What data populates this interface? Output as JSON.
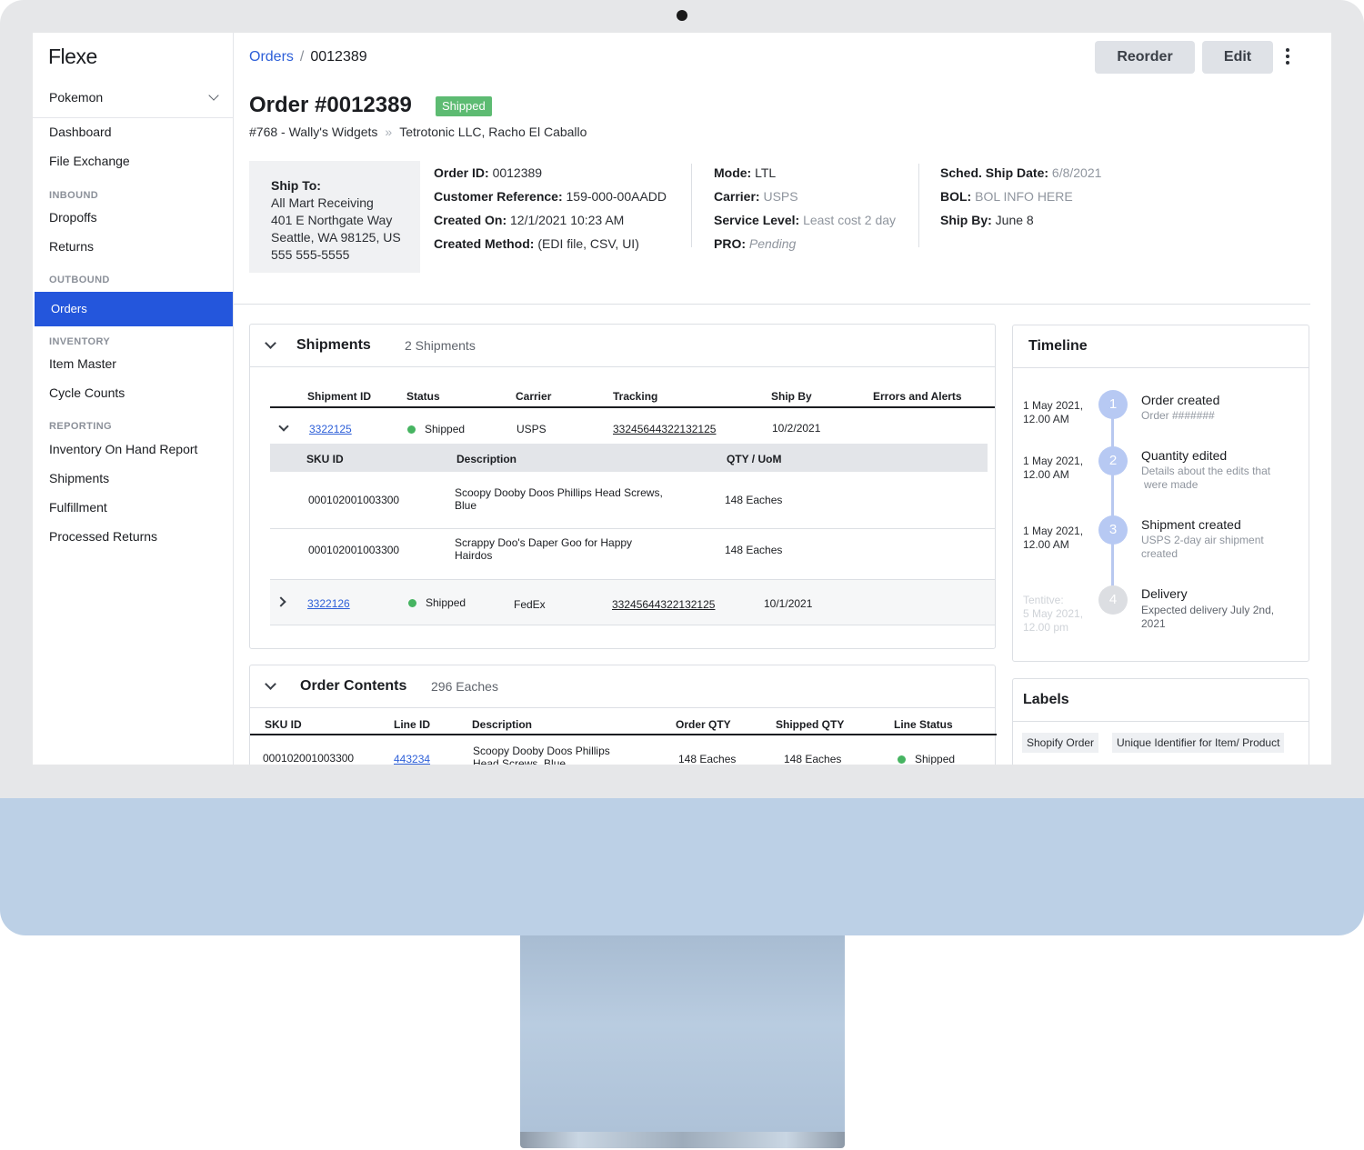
{
  "sidebar": {
    "logo": "Flexe",
    "workspace": "Pokemon",
    "items": {
      "dashboard": "Dashboard",
      "file_exchange": "File Exchange",
      "inbound": "INBOUND",
      "dropoffs": "Dropoffs",
      "returns": "Returns",
      "outbound": "OUTBOUND",
      "orders": "Orders",
      "inventory": "INVENTORY",
      "item_master": "Item Master",
      "cycle_counts": "Cycle Counts",
      "reporting": "REPORTING",
      "inventory_on_hand": "Inventory On Hand Report",
      "shipments": "Shipments",
      "fulfillment": "Fulfillment",
      "processed_returns": "Processed Returns"
    }
  },
  "header": {
    "breadcrumb_link": "Orders",
    "breadcrumb_sep": "/",
    "breadcrumb_current": "0012389",
    "reorder": "Reorder",
    "edit": "Edit"
  },
  "order": {
    "title": "Order #0012389",
    "status": "Shipped",
    "account": "#768 - Wally's Widgets",
    "separator": "»",
    "partner": "Tetrotonic LLC, Racho El Caballo"
  },
  "ship_to": {
    "label": "Ship To:",
    "line1": "All Mart Receiving",
    "line2": "401 E Northgate Way",
    "line3": "Seattle, WA 98125, US",
    "line4": "555 555-5555"
  },
  "details": {
    "order_id_label": "Order ID:",
    "order_id": "0012389",
    "cust_ref_label": "Customer Reference:",
    "cust_ref": "159-000-00AADD",
    "created_on_label": "Created On:",
    "created_on": "12/1/2021 10:23 AM",
    "created_method_label": "Created Method:",
    "created_method": "(EDI file, CSV, UI)",
    "mode_label": "Mode:",
    "mode": "LTL",
    "carrier_label": "Carrier:",
    "carrier": "USPS",
    "service_label": "Service Level:",
    "service": "Least cost 2 day",
    "pro_label": "PRO:",
    "pro": "Pending",
    "sched_label": "Sched. Ship Date:",
    "sched": "6/8/2021",
    "bol_label": "BOL:",
    "bol": "BOL INFO HERE",
    "ship_by_label": "Ship By:",
    "ship_by": "June 8"
  },
  "shipments": {
    "title": "Shipments",
    "count": "2 Shipments",
    "headers": [
      "Shipment ID",
      "Status",
      "Carrier",
      "Tracking",
      "Ship By",
      "Errors and Alerts"
    ],
    "sub_headers": [
      "SKU ID",
      "Description",
      "QTY / UoM"
    ],
    "rows": [
      {
        "id": "3322125",
        "status": "Shipped",
        "carrier": "USPS",
        "tracking": "33245644322132125",
        "ship_by": "10/2/2021",
        "items": [
          {
            "sku": "000102001003300",
            "desc1": "Scoopy Dooby Doos Phillips Head Screws,",
            "desc2": "Blue",
            "qty": "148 Eaches"
          },
          {
            "sku": "000102001003300",
            "desc1": "Scrappy Doo's Daper Goo for Happy",
            "desc2": "Hairdos",
            "qty": "148 Eaches"
          }
        ]
      },
      {
        "id": "3322126",
        "status": "Shipped",
        "carrier": "FedEx",
        "tracking": "33245644322132125",
        "ship_by": "10/1/2021"
      }
    ]
  },
  "contents": {
    "title": "Order Contents",
    "count": "296 Eaches",
    "headers": [
      "SKU ID",
      "Line ID",
      "Description",
      "Order QTY",
      "Shipped QTY",
      "Line Status"
    ],
    "rows": [
      {
        "sku": "000102001003300",
        "line_id": "443234",
        "desc1": "Scoopy Dooby Doos Phillips",
        "desc2": "Head Screws, Blue",
        "order_qty": "148 Eaches",
        "shipped_qty": "148 Eaches",
        "status": "Shipped"
      }
    ]
  },
  "timeline": {
    "title": "Timeline",
    "events": [
      {
        "num": "1",
        "date1": "1 May 2021,",
        "date2": "12.00 AM",
        "title": "Order created",
        "desc1": "Order #######",
        "desc2": ""
      },
      {
        "num": "2",
        "date1": "1 May 2021,",
        "date2": "12.00 AM",
        "title": "Quantity edited",
        "desc1": "Details about the edits that",
        "desc2": "were made"
      },
      {
        "num": "3",
        "date1": "1 May 2021,",
        "date2": "12.00 AM",
        "title": "Shipment created",
        "desc1": "USPS 2-day air shipment",
        "desc2": "created"
      },
      {
        "num": "4",
        "date0": "Tentitve:",
        "date1": "5 May 2021,",
        "date2": "12.00 pm",
        "title": "Delivery",
        "desc1": "Expected delivery July 2nd,",
        "desc2": "2021"
      }
    ]
  },
  "labels": {
    "title": "Labels",
    "chips": [
      "Shopify Order",
      "Unique Identifier for Item/ Product"
    ]
  },
  "colors": {
    "accent": "#2456dc",
    "link": "#2d5fd8",
    "success": "#5dbb72",
    "timeline": "#b7c9f3",
    "chin": "#bcd0e6"
  }
}
